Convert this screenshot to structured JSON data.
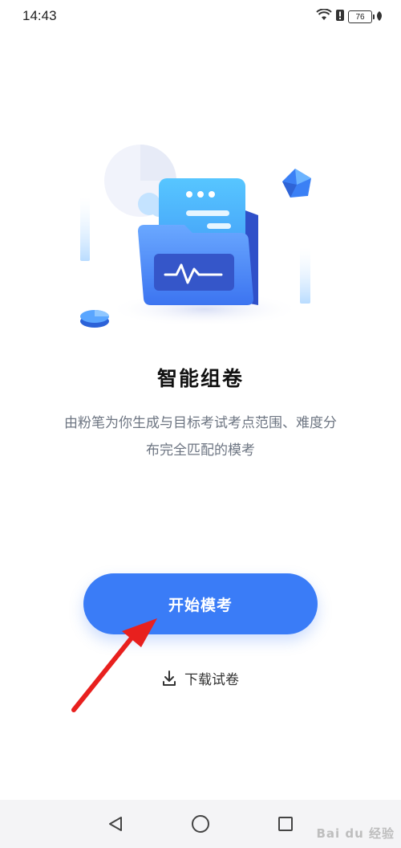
{
  "status_bar": {
    "time": "14:43",
    "battery": "76"
  },
  "main": {
    "title": "智能组卷",
    "description_line1": "由粉笔为你生成与目标考试考点范围、难度分",
    "description_line2": "布完全匹配的模考",
    "start_button_label": "开始模考",
    "download_label": "下载试卷"
  },
  "nav_bar": {
    "back_icon": "triangle-back-icon",
    "home_icon": "circle-home-icon",
    "recents_icon": "square-recents-icon"
  },
  "watermark": {
    "text": "Bai du 经验"
  },
  "colors": {
    "accent": "#3a7cf7",
    "annotation_arrow": "#e8201e"
  }
}
